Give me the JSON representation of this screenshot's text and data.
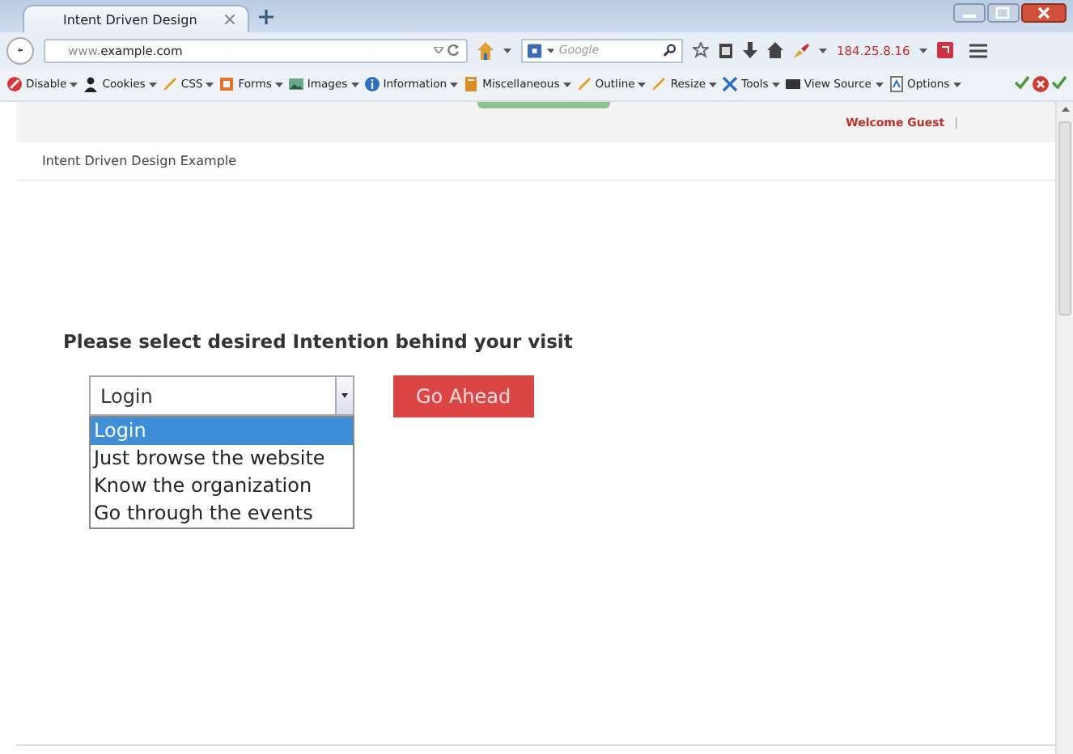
{
  "tabs": [
    {
      "label": "Intent Driven Design",
      "selected": true
    }
  ],
  "address_bar": {
    "url": "www.**example.com**"
  },
  "search": {
    "placeholder": "Google"
  },
  "ip_label": "184.25.8.16",
  "toolbar": [
    {
      "kind": "disable",
      "label": "Disable"
    },
    {
      "kind": "cookies",
      "label": "Cookies"
    },
    {
      "kind": "css",
      "label": "CSS"
    },
    {
      "kind": "forms",
      "label": "Forms"
    },
    {
      "kind": "images",
      "label": "Images"
    },
    {
      "kind": "information",
      "label": "Information"
    },
    {
      "kind": "miscellaneous",
      "label": "Miscellaneous"
    },
    {
      "kind": "outline",
      "label": "Outline"
    },
    {
      "kind": "resize",
      "label": "Resize"
    },
    {
      "kind": "tools",
      "label": "Tools"
    },
    {
      "kind": "view_source",
      "label": "View Source"
    },
    {
      "kind": "options",
      "label": "Options"
    }
  ],
  "header": {
    "welcome": "Welcome Guest",
    "separator": "|"
  },
  "page_title": "Intent Driven Design Example",
  "prompt": "Please select desired Intention behind your visit",
  "select": {
    "value": "Login",
    "expanded": true,
    "options": [
      {
        "label": "Login",
        "selected": true
      },
      {
        "label": "Just browse the website",
        "selected": false
      },
      {
        "label": "Know the organization",
        "selected": false
      },
      {
        "label": "Go through the events",
        "selected": false
      }
    ]
  },
  "submit_button": "Go Ahead"
}
